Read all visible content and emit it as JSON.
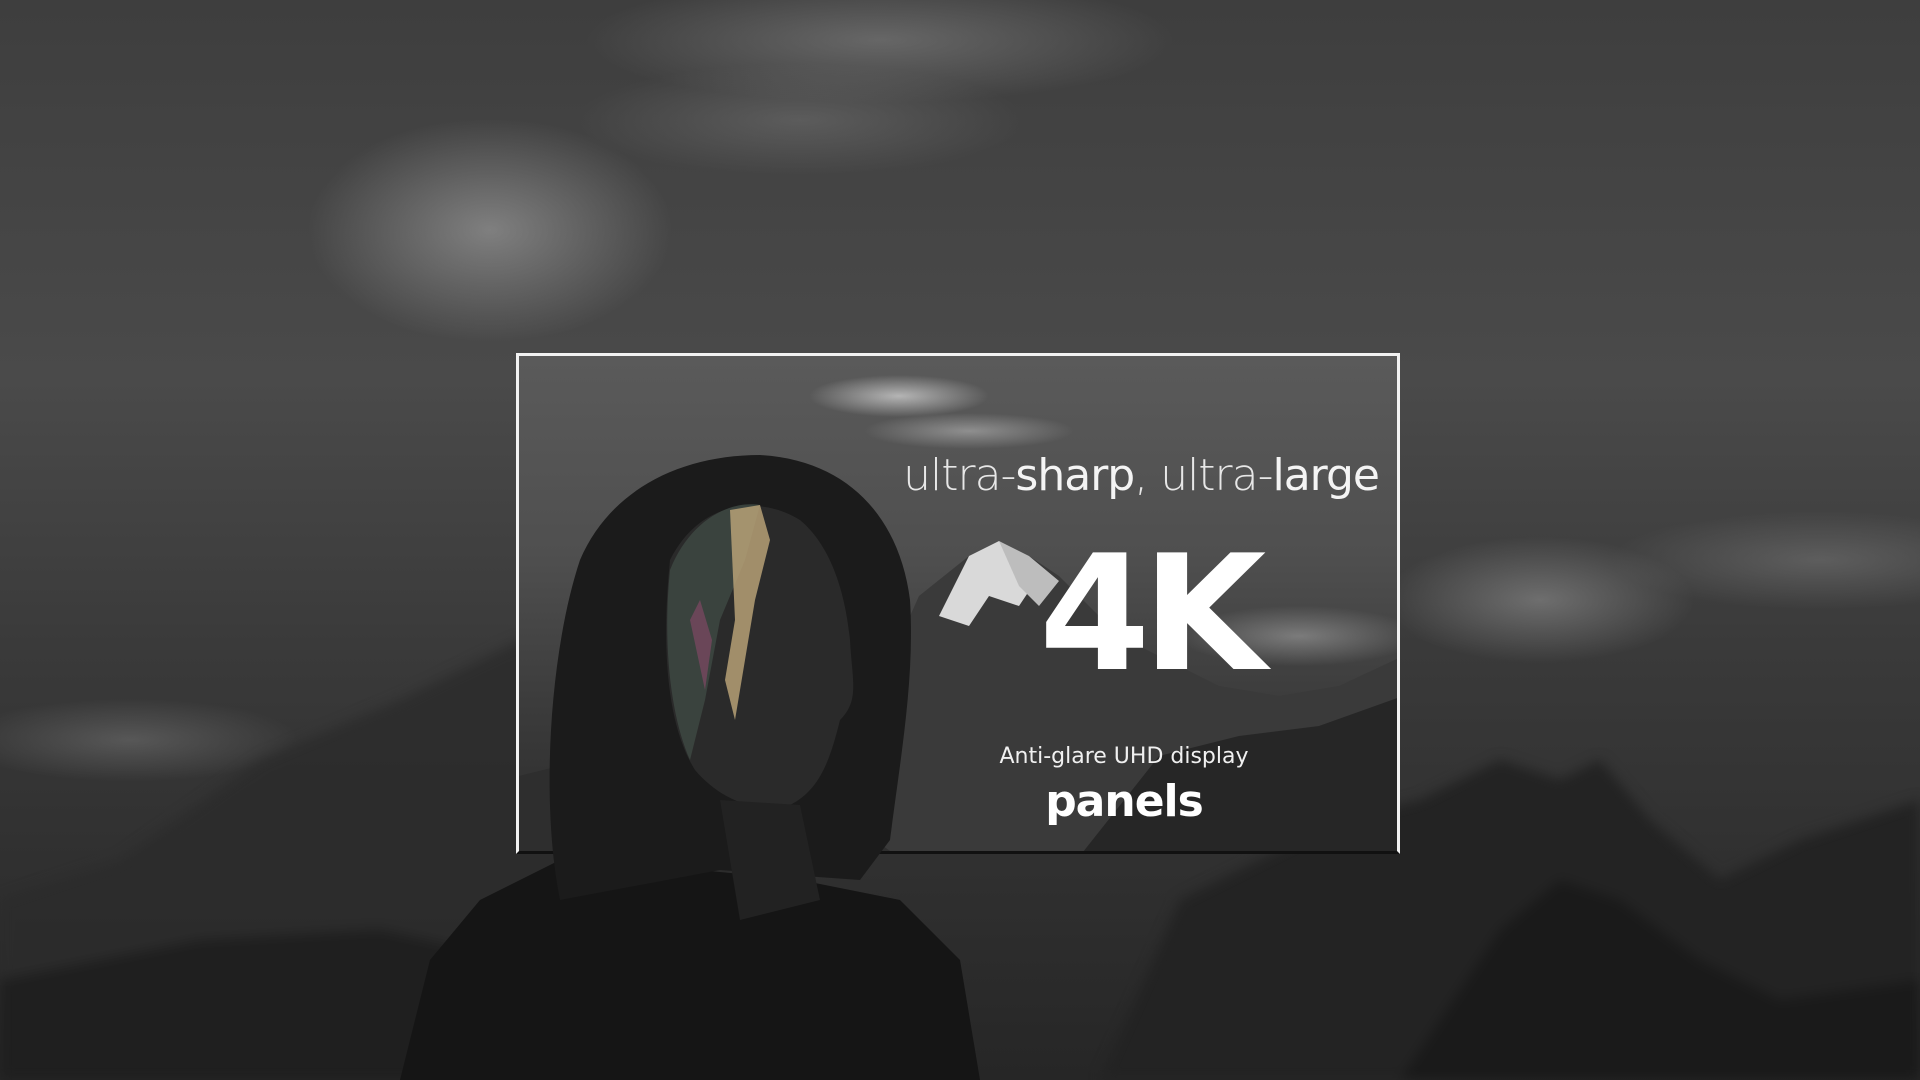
{
  "banner": {
    "tagline_part1": "ultra-",
    "tagline_part2": "sharp",
    "tagline_part3": ", ultra-",
    "tagline_part4": "large",
    "headline": "4K",
    "subline": "Anti-glare UHD display",
    "product": "panels"
  },
  "colors": {
    "frame_border": "#f2f2f2",
    "text": "#ffffff",
    "background": "#3a3a3a"
  }
}
